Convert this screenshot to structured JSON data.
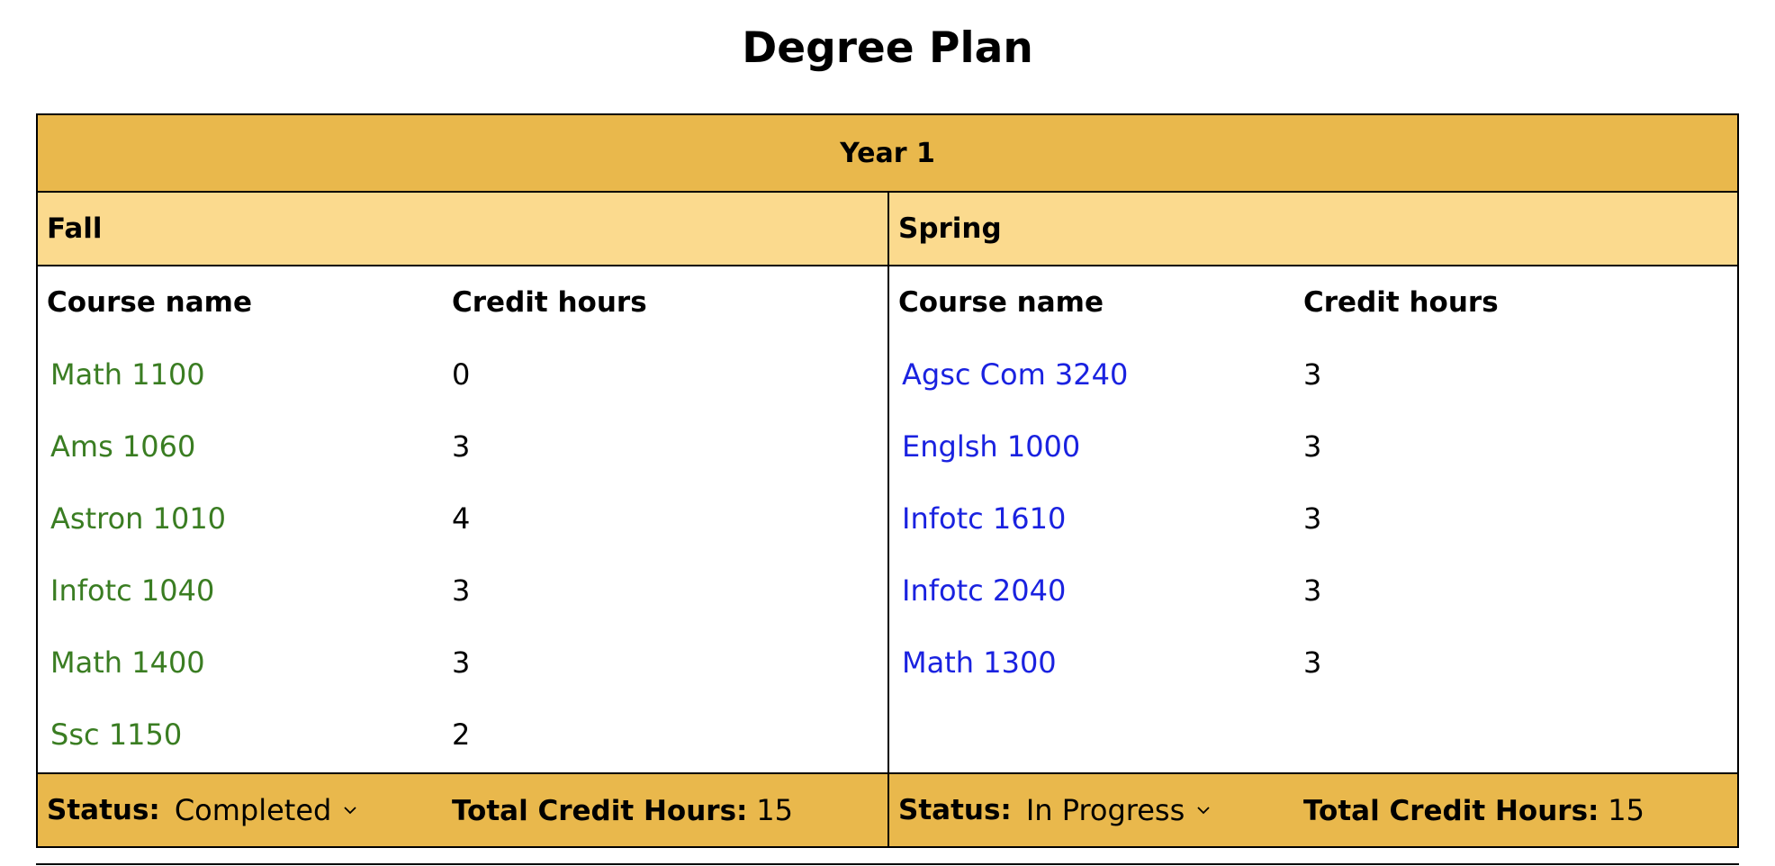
{
  "page": {
    "title": "Degree Plan"
  },
  "year": {
    "label": "Year 1"
  },
  "columns": {
    "course_name": "Course name",
    "credit_hours": "Credit hours"
  },
  "footer_labels": {
    "status": "Status:",
    "total": "Total Credit Hours:"
  },
  "colors": {
    "year_header_bg": "#e9b84c",
    "semester_header_bg": "#fbda8e",
    "completed_link": "#3a7d22",
    "in_progress_link": "#1a22e0"
  },
  "fall": {
    "label": "Fall",
    "status": "Completed",
    "total": "15",
    "courses": [
      {
        "name": "Math 1100",
        "hours": "0"
      },
      {
        "name": "Ams 1060",
        "hours": "3"
      },
      {
        "name": "Astron 1010",
        "hours": "4"
      },
      {
        "name": "Infotc 1040",
        "hours": "3"
      },
      {
        "name": "Math 1400",
        "hours": "3"
      },
      {
        "name": "Ssc 1150",
        "hours": "2"
      }
    ]
  },
  "spring": {
    "label": "Spring",
    "status": "In Progress",
    "total": "15",
    "courses": [
      {
        "name": "Agsc Com 3240",
        "hours": "3"
      },
      {
        "name": "Englsh 1000",
        "hours": "3"
      },
      {
        "name": "Infotc 1610",
        "hours": "3"
      },
      {
        "name": "Infotc 2040",
        "hours": "3"
      },
      {
        "name": "Math 1300",
        "hours": "3"
      }
    ]
  }
}
